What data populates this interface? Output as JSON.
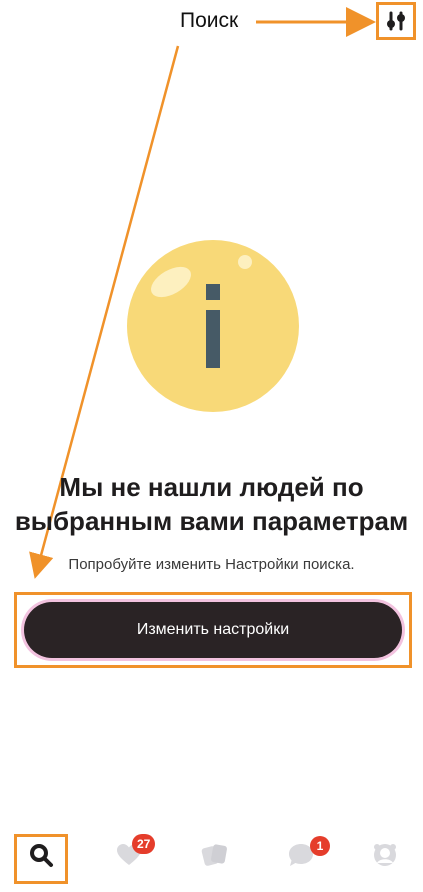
{
  "header": {
    "annotation_label": "Поиск",
    "filter_icon": "filter-sliders-icon"
  },
  "empty_state": {
    "illustration_icon": "info-icon",
    "headline_line1": "Мы не нашли людей по",
    "headline_line2": "выбранным вами параметрам",
    "subtext": "Попробуйте изменить Настройки поиска."
  },
  "cta": {
    "label": "Изменить настройки"
  },
  "bottom_nav": {
    "items": [
      {
        "icon": "search-icon",
        "badge": ""
      },
      {
        "icon": "likes-icon",
        "badge": "27"
      },
      {
        "icon": "cards-icon",
        "badge": ""
      },
      {
        "icon": "chat-icon",
        "badge": "1"
      },
      {
        "icon": "profile-icon",
        "badge": ""
      }
    ]
  },
  "colors": {
    "annotation": "#f0922a",
    "button_dark": "#2a2325",
    "button_glow": "#f2c2df",
    "badge": "#e53d2b",
    "info_yellow": "#f8d978"
  }
}
